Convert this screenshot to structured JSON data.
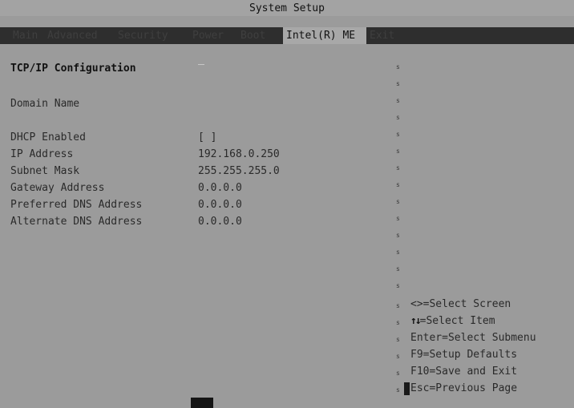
{
  "window": {
    "title": "System Setup"
  },
  "menu": {
    "items": [
      {
        "label": "Main"
      },
      {
        "label": "Advanced"
      },
      {
        "label": "Security"
      },
      {
        "label": "Power"
      },
      {
        "label": "Boot"
      },
      {
        "label": "Intel(R) ME",
        "active": true
      },
      {
        "label": "Exit"
      }
    ]
  },
  "config": {
    "section_title": "TCP/IP Configuration",
    "domain_name": {
      "label": "Domain Name",
      "value": ""
    },
    "dhcp_enabled": {
      "label": "DHCP Enabled",
      "value": "[ ]"
    },
    "ip_address": {
      "label": "IP Address",
      "value": "192.168.0.250"
    },
    "subnet_mask": {
      "label": "Subnet Mask",
      "value": "255.255.255.0"
    },
    "gateway_address": {
      "label": "Gateway Address",
      "value": "0.0.0.0"
    },
    "preferred_dns": {
      "label": "Preferred DNS Address",
      "value": "0.0.0.0"
    },
    "alternate_dns": {
      "label": "Alternate DNS Address",
      "value": "0.0.0.0"
    }
  },
  "help": {
    "select_screen": "<>=Select Screen",
    "select_item": "=Select Item",
    "select_item_icon": "up-down-arrow-icon",
    "enter_submenu": "Enter=Select Submenu",
    "setup_defaults": "F9=Setup Defaults",
    "save_exit": "F10=Save and Exit",
    "prev_page": "Esc=Previous Page"
  },
  "divider_glyph": "s"
}
